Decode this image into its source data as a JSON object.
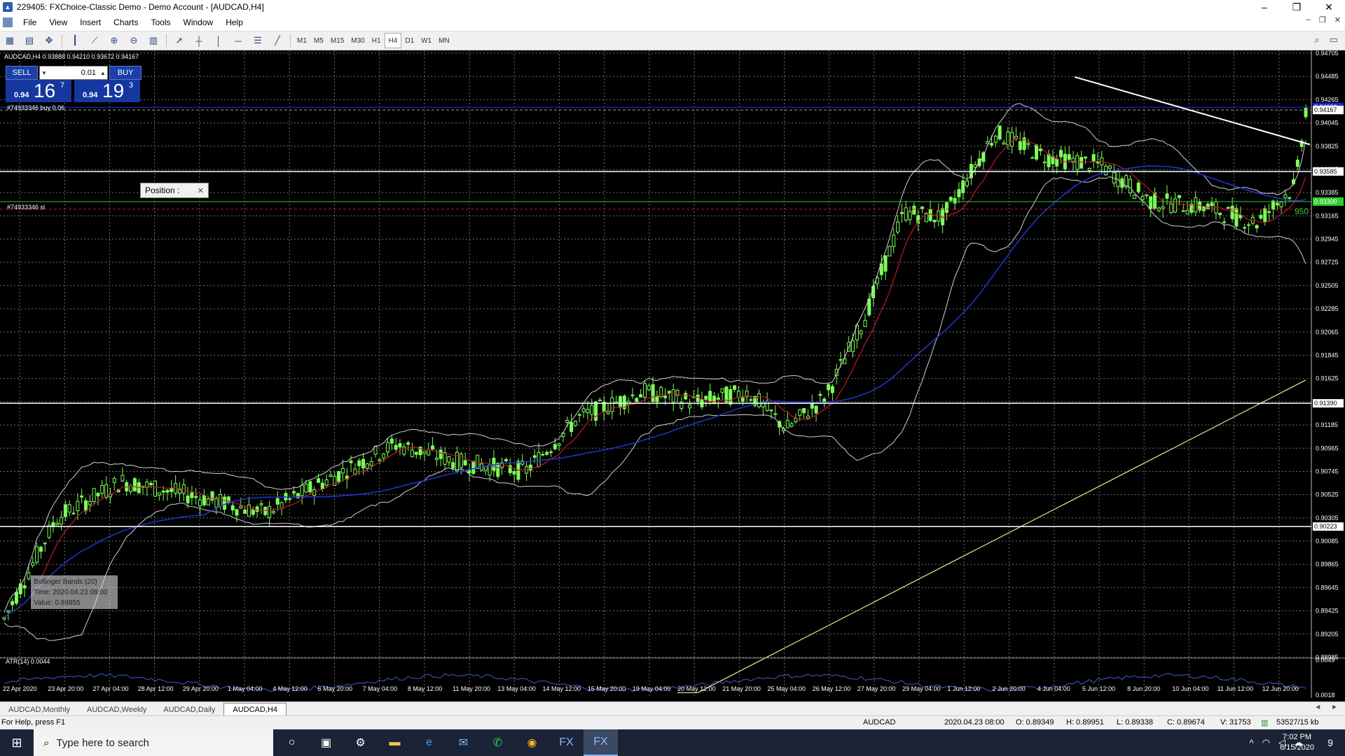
{
  "window": {
    "title": "229405: FXChoice-Classic Demo - Demo Account - [AUDCAD,H4]",
    "min": "–",
    "max": "❐",
    "close": "✕"
  },
  "menu": [
    "File",
    "View",
    "Insert",
    "Charts",
    "Tools",
    "Window",
    "Help"
  ],
  "timeframes": [
    "M1",
    "M5",
    "M15",
    "M30",
    "H1",
    "H4",
    "D1",
    "W1",
    "MN"
  ],
  "active_timeframe": "H4",
  "chart": {
    "info": "AUDCAD,H4  0.93888 0.94210 0.93672 0.94167",
    "sell_label": "SELL",
    "buy_label": "BUY",
    "lot": "0.01",
    "sell_small": "0.94",
    "sell_big": "16",
    "sell_sup": "7",
    "buy_small": "0.94",
    "buy_big": "19",
    "buy_sup": "3",
    "order_label": "#74933346 buy 0.06",
    "sl_label": "#74933346 sl",
    "position_widget": "Position :",
    "sl_value": "950",
    "tooltip": [
      "Bollinger Bands (20)",
      "Time: 2020.04.23 08:00",
      "Value: 0.89855"
    ],
    "atr_label": "ATR(14) 0.0044",
    "price_axis": [
      "0.94705",
      "0.94485",
      "0.94265",
      "0.94045",
      "0.93825",
      "0.93605",
      "0.93385",
      "0.93165",
      "0.92945",
      "0.92725",
      "0.92505",
      "0.92285",
      "0.92065",
      "0.91845",
      "0.91625",
      "0.91405",
      "0.91185",
      "0.90965",
      "0.90745",
      "0.90525",
      "0.90305",
      "0.90085",
      "0.89865",
      "0.89645",
      "0.89425",
      "0.89205",
      "0.88985"
    ],
    "price_tags": [
      {
        "label": "0.94193",
        "color": "#1a2fd8"
      },
      {
        "label": "0.94167",
        "color": "#ffffff"
      },
      {
        "label": "0.93585",
        "color": "#ffffff"
      },
      {
        "label": "0.93300",
        "color": "#2ecc2e"
      },
      {
        "label": "0.91390",
        "color": "#ffffff"
      },
      {
        "label": "0.90223",
        "color": "#ffffff"
      }
    ],
    "atr_axis": [
      "0.0049",
      "0.0018"
    ],
    "time_axis": [
      "22 Apr 2020",
      "23 Apr 20:00",
      "27 Apr 04:00",
      "28 Apr 12:00",
      "29 Apr 20:00",
      "1 May 04:00",
      "4 May 12:00",
      "5 May 20:00",
      "7 May 04:00",
      "8 May 12:00",
      "11 May 20:00",
      "13 May 04:00",
      "14 May 12:00",
      "15 May 20:00",
      "19 May 04:00",
      "20 May 12:00",
      "21 May 20:00",
      "25 May 04:00",
      "26 May 12:00",
      "27 May 20:00",
      "29 May 04:00",
      "1 Jun 12:00",
      "2 Jun 20:00",
      "4 Jun 04:00",
      "5 Jun 12:00",
      "8 Jun 20:00",
      "10 Jun 04:00",
      "11 Jun 12:00",
      "12 Jun 20:00"
    ],
    "colors": {
      "background": "#000000",
      "candle": "#7dff5a",
      "grid": "#707070",
      "ma_fast": "#c0182a",
      "ma_slow": "#1f36d6",
      "ma_long": "#f0e68c",
      "bands": "#d0d0d0",
      "sell_bg": "#1636a0"
    }
  },
  "tabs": [
    "AUDCAD,Monthly",
    "AUDCAD,Weekly",
    "AUDCAD,Daily",
    "AUDCAD,H4"
  ],
  "active_tab": "AUDCAD,H4",
  "tab_nav": [
    "◄",
    "►"
  ],
  "status": {
    "help": "For Help, press F1",
    "symbol": "AUDCAD",
    "time": "2020.04.23 08:00",
    "open": "O: 0.89349",
    "high": "H: 0.89951",
    "low": "L: 0.89338",
    "close": "C: 0.89674",
    "volume": "V: 31753",
    "traffic": "53527/15 kb"
  },
  "taskbar": {
    "search_placeholder": "Type here to search",
    "time": "7:02 PM",
    "date": "6/15/2020",
    "notif_count": "9"
  }
}
